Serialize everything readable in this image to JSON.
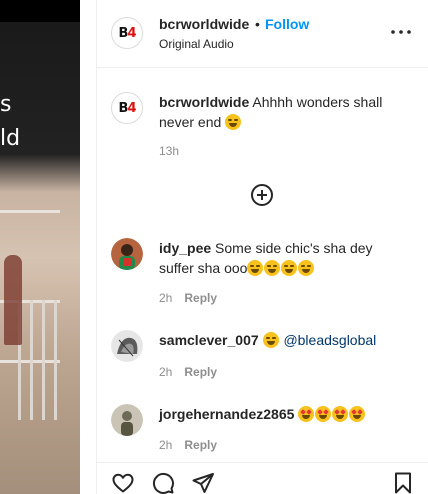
{
  "video": {
    "caption_line1": "s",
    "caption_line2": "ld"
  },
  "header": {
    "username": "bcrworldwide",
    "separator": "•",
    "follow_label": "Follow",
    "audio_label": "Original Audio",
    "more_icon": "more-horizontal-icon"
  },
  "caption": {
    "username": "bcrworldwide",
    "text": "Ahhhh wonders shall never end",
    "time": "13h"
  },
  "load_more_icon": "plus-circle-icon",
  "comments": [
    {
      "username": "idy_pee",
      "text": "Some side chic's sha dey suffer sha ooo",
      "time": "2h",
      "reply_label": "Reply"
    },
    {
      "username": "samclever_007",
      "mention": "@bleadsglobal",
      "time": "2h",
      "reply_label": "Reply"
    },
    {
      "username": "jorgehernandez2865",
      "time": "2h",
      "reply_label": "Reply"
    }
  ],
  "actions": {
    "like_icon": "heart-icon",
    "comment_icon": "comment-icon",
    "share_icon": "send-icon",
    "save_icon": "bookmark-icon"
  },
  "colors": {
    "accent": "#0095f6",
    "mention": "#00376b",
    "muted": "#8e8e8e"
  }
}
